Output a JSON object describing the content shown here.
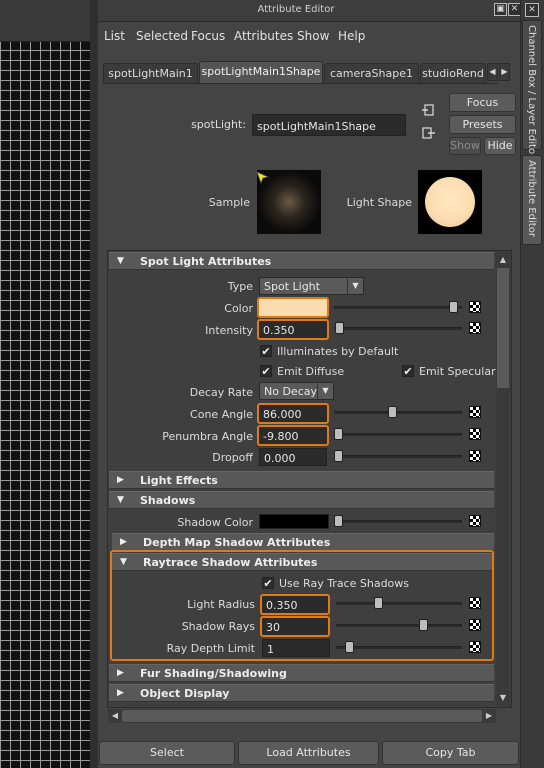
{
  "window": {
    "title": "Attribute Editor"
  },
  "menu": [
    "List",
    "Selected",
    "Focus",
    "Attributes",
    "Show",
    "Help"
  ],
  "tabs": [
    "spotLightMain1",
    "spotLightMain1Shape",
    "cameraShape1",
    "studioRend"
  ],
  "node": {
    "label": "spotLight:",
    "value": "spotLightMain1Shape"
  },
  "buttons": {
    "focus": "Focus",
    "presets": "Presets",
    "show": "Show",
    "hide": "Hide"
  },
  "preview": {
    "sample_label": "Sample",
    "light_shape_label": "Light Shape"
  },
  "sections": {
    "spot_light": "Spot Light Attributes",
    "light_effects": "Light Effects",
    "shadows": "Shadows",
    "depth_map": "Depth Map Shadow Attributes",
    "raytrace": "Raytrace Shadow Attributes",
    "fur": "Fur Shading/Shadowing",
    "object_display": "Object Display"
  },
  "spot": {
    "type_label": "Type",
    "type_value": "Spot Light",
    "color_label": "Color",
    "intensity_label": "Intensity",
    "intensity_value": "0.350",
    "illuminates": "Illuminates by Default",
    "emit_diffuse": "Emit Diffuse",
    "emit_specular": "Emit Specular",
    "decay_label": "Decay Rate",
    "decay_value": "No Decay",
    "cone_label": "Cone Angle",
    "cone_value": "86.000",
    "penumbra_label": "Penumbra Angle",
    "penumbra_value": "-9.800",
    "dropoff_label": "Dropoff",
    "dropoff_value": "0.000"
  },
  "shadows": {
    "shadow_color_label": "Shadow Color"
  },
  "raytrace": {
    "use_label": "Use Ray Trace Shadows",
    "radius_label": "Light Radius",
    "radius_value": "0.350",
    "rays_label": "Shadow Rays",
    "rays_value": "30",
    "depth_label": "Ray Depth Limit",
    "depth_value": "1"
  },
  "bottom": {
    "select": "Select",
    "load": "Load Attributes",
    "copy": "Copy Tab"
  },
  "dock_tabs": [
    "Channel Box / Layer Editor",
    "Attribute Editor"
  ],
  "colors": {
    "accent_highlight": "#e07a12",
    "light_color": "#fbdcb0"
  }
}
